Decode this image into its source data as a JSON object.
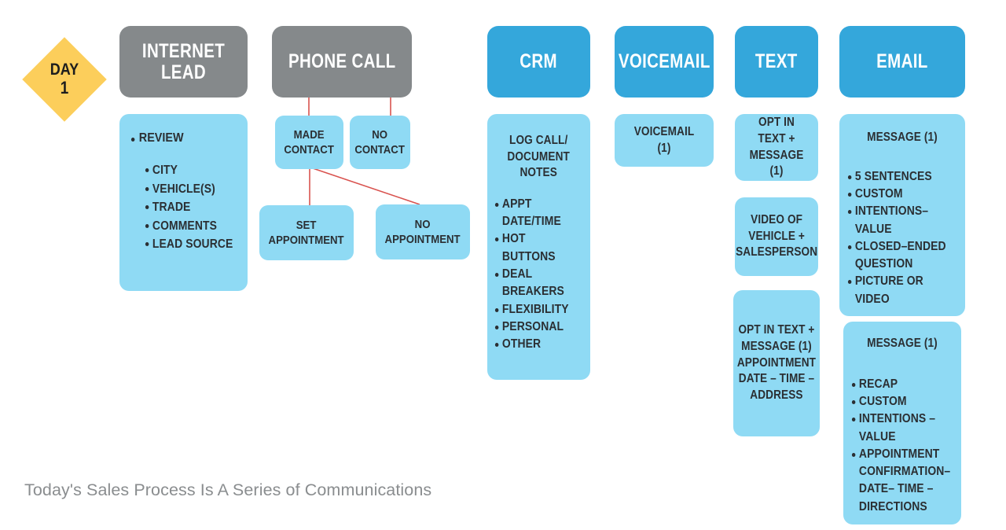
{
  "diagram": {
    "caption": "Today's Sales Process Is A Series of Communications",
    "colors": {
      "background": "#ffffff",
      "header_grey": "#85898b",
      "header_blue": "#34a7db",
      "panel_light_blue": "#8fdaf4",
      "diamond_yellow": "#fcce5b",
      "connector_red": "#d9534f",
      "text_dark": "#2b2f33",
      "caption_grey": "#8a8d8f"
    },
    "day_marker": {
      "line1": "DAY",
      "line2": "1"
    },
    "columns": {
      "internet_lead": {
        "header": "INTERNET LEAD",
        "panel": {
          "lead_item": "REVIEW",
          "sub_items": [
            "CITY",
            "VEHICLE(S)",
            "TRADE",
            "COMMENTS",
            "LEAD SOURCE"
          ]
        }
      },
      "phone_call": {
        "header": "PHONE CALL",
        "nodes": {
          "made_contact": "MADE\nCONTACT",
          "no_contact": "NO\nCONTACT",
          "set_appointment": "SET\nAPPOINTMENT",
          "no_appointment": "NO\nAPPOINTMENT"
        }
      },
      "crm": {
        "header": "CRM",
        "panel": {
          "title": "LOG CALL/\nDOCUMENT\nNOTES",
          "items": [
            "APPT DATE/TIME",
            "HOT BUTTONS",
            "DEAL BREAKERS",
            "FLEXIBILITY",
            "PERSONAL",
            "OTHER"
          ]
        }
      },
      "voicemail": {
        "header": "VOICEMAIL",
        "panels": [
          {
            "title": "VOICEMAIL (1)"
          }
        ]
      },
      "text": {
        "header": "TEXT",
        "panels": [
          {
            "title": "OPT IN TEXT +\nMESSAGE (1)"
          },
          {
            "title": "VIDEO OF\nVEHICLE +\nSALESPERSON"
          },
          {
            "title": "OPT IN TEXT +\nMESSAGE (1)\nAPPOINTMENT\nDATE – TIME –\nADDRESS"
          }
        ]
      },
      "email": {
        "header": "EMAIL",
        "panels": [
          {
            "title": "MESSAGE (1)",
            "items": [
              "5 SENTENCES",
              "CUSTOM",
              "INTENTIONS– VALUE",
              "CLOSED–ENDED QUESTION",
              "PICTURE OR VIDEO"
            ]
          },
          {
            "title": "MESSAGE (1)",
            "items": [
              "RECAP",
              "CUSTOM",
              "INTENTIONS – VALUE",
              "APPOINTMENT CONFIRMATION– DATE– TIME – DIRECTIONS"
            ]
          }
        ]
      }
    }
  }
}
